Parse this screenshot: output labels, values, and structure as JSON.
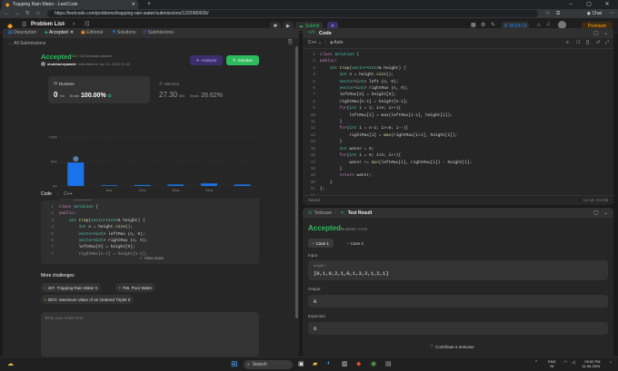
{
  "browser": {
    "tab_title": "Trapping Rain Water - LeetCode",
    "url": "https://leetcode.com/problems/trapping-rain-water/submissions/1202989935/",
    "chat_label": "Chat"
  },
  "lc_header": {
    "problem_list": "Problem List",
    "submit_label": "Submit",
    "timer": "00:14:12",
    "premium_label": "Premium"
  },
  "left_tabs": [
    "Description",
    "Accepted",
    "Editorial",
    "Solutions",
    "Submissions"
  ],
  "back_link": "All Submissions",
  "submission": {
    "status": "Accepted",
    "cases": "324 / 324 testcases passed",
    "user": "shubhamrpawde",
    "submitted_at": "submitted at Jun 14, 2024 21:52",
    "analysis_label": "Analysis",
    "solution_label": "Solution"
  },
  "runtime": {
    "label": "Runtime",
    "value": "0",
    "unit": "ms",
    "beats_label": "Beats",
    "beats": "100.00%"
  },
  "memory": {
    "label": "Memory",
    "value": "27.30",
    "unit": "MB",
    "beats_label": "Beats",
    "beats": "26.62%"
  },
  "chart_data": {
    "type": "bar",
    "yticks": [
      "100%",
      "50%",
      "0%"
    ],
    "ylim": [
      0,
      100
    ],
    "categories": [
      "0ms",
      "5ms",
      "10ms",
      "15ms",
      "20ms",
      "25ms"
    ],
    "values": [
      48,
      0,
      2,
      3,
      5,
      3
    ],
    "xticks": [
      "5ms",
      "10ms",
      "15ms",
      "20ms"
    ],
    "range_ticks": [
      "1ms",
      "3ms",
      "5ms",
      "6ms"
    ],
    "highlight_color": "#1a73e8"
  },
  "code_section": {
    "label": "Code",
    "lang": "C++",
    "lines": [
      "class Solution {",
      "public:",
      "    int trap(vector<int>& height) {",
      "        int n = height.size();",
      "        vector<int> leftMax (n, 0);",
      "        vector<int> rightMax (n, 0);",
      "        leftMax[0] = height[0];",
      "        rightMax[n-1] = height[n-1];"
    ],
    "view_more": "View more"
  },
  "more_challenges": {
    "label": "More challenges",
    "items": [
      "407. Trapping Rain Water II",
      "755. Pour Water",
      "2874. Maximum Value of an Ordered Triplet II"
    ]
  },
  "notes_placeholder": "Write your notes here",
  "editor": {
    "title": "Code",
    "lang": "C++",
    "mode": "Auto",
    "lines": [
      "class Solution {",
      "public:",
      "    int trap(vector<int>& height) {",
      "        int n = height.size();",
      "        vector<int> left (n, 0);",
      "        vector<int> rightMax (n, 0);",
      "        leftMax[0] = height[0];",
      "        rightMax[n-1] = height[n-1];",
      "",
      "        for(int i = 1; i<n; i++){",
      "            leftMax[i] = max(leftMax[i-1], height[i]);",
      "        }",
      "",
      "        for(int i = n-2; i>=0; i--){",
      "            rightMax[i] = max(rightMax[i+1], height[i]);",
      "        }",
      "",
      "        int water = 0;",
      "        for(int i = 0; i<n; i++){",
      "            water += min(leftMax[i], rightMax[i]) - height[i];",
      "        }",
      "",
      "        return water;",
      "    }",
      "};"
    ],
    "status_left": "Saved",
    "status_right": "Ln 14, Col 33"
  },
  "test": {
    "tab_testcase": "Testcase",
    "tab_result": "Test Result",
    "status": "Accepted",
    "runtime": "Runtime: 0 ms",
    "cases": [
      "Case 1",
      "Case 2"
    ],
    "input_label": "Input",
    "input_name": "height =",
    "input_value": "[0,1,0,2,1,0,1,3,2,1,2,1]",
    "output_label": "Output",
    "output_value": "6",
    "expected_label": "Expected",
    "expected_value": "6",
    "contribute": "Contribute a testcase"
  },
  "taskbar": {
    "search": "Search",
    "lang": "ENG",
    "region": "IN",
    "time": "09:52 PM",
    "date": "14-06-2024"
  }
}
